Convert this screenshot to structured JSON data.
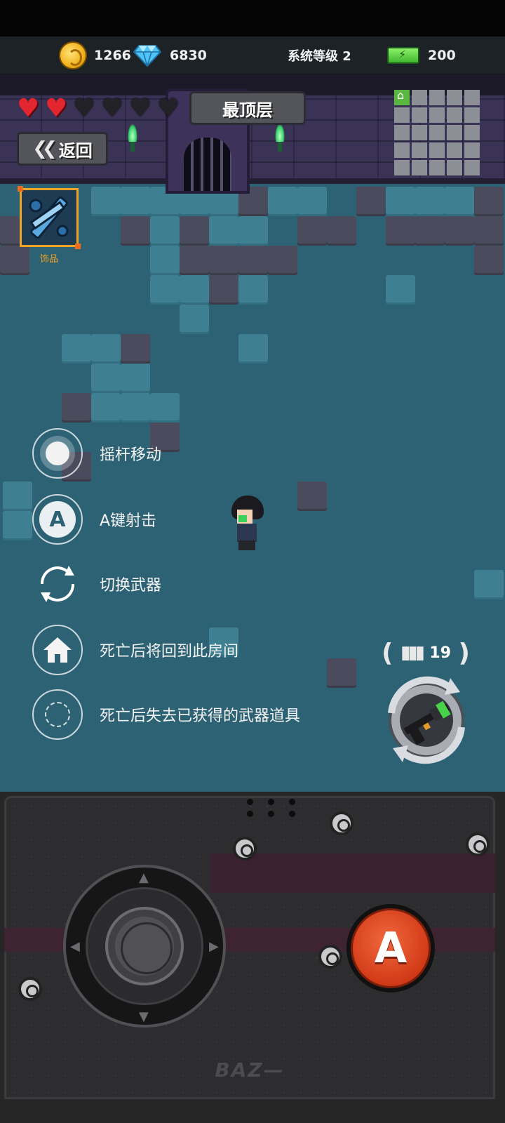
{
  "resources": {
    "coins": "1266",
    "gems": "6830",
    "system_level": "系统等级 2",
    "energy": "200"
  },
  "hud": {
    "hearts_full": 2,
    "hearts_total": 6,
    "floor_title": "最顶层",
    "back_label": "返回",
    "accessory_label": "饰品"
  },
  "hints": [
    {
      "icon": "joystick-icon",
      "text": "摇杆移动"
    },
    {
      "icon": "a-button-icon",
      "text": "A键射击"
    },
    {
      "icon": "switch-weapon-icon",
      "text": "切换武器"
    },
    {
      "icon": "home-icon",
      "text": "死亡后将回到此房间"
    },
    {
      "icon": "dashed-circle-icon",
      "text": "死亡后失去已获得的武器道具"
    }
  ],
  "weapon": {
    "ammo": "19",
    "weapon_icon": "shotgun-icon"
  },
  "controller": {
    "a_label": "A",
    "brand": "BAZ—"
  },
  "colors": {
    "floor": "#2d6275",
    "accent_orange": "#f0a426",
    "a_button": "#d23a17",
    "heart": "#e3262f"
  }
}
